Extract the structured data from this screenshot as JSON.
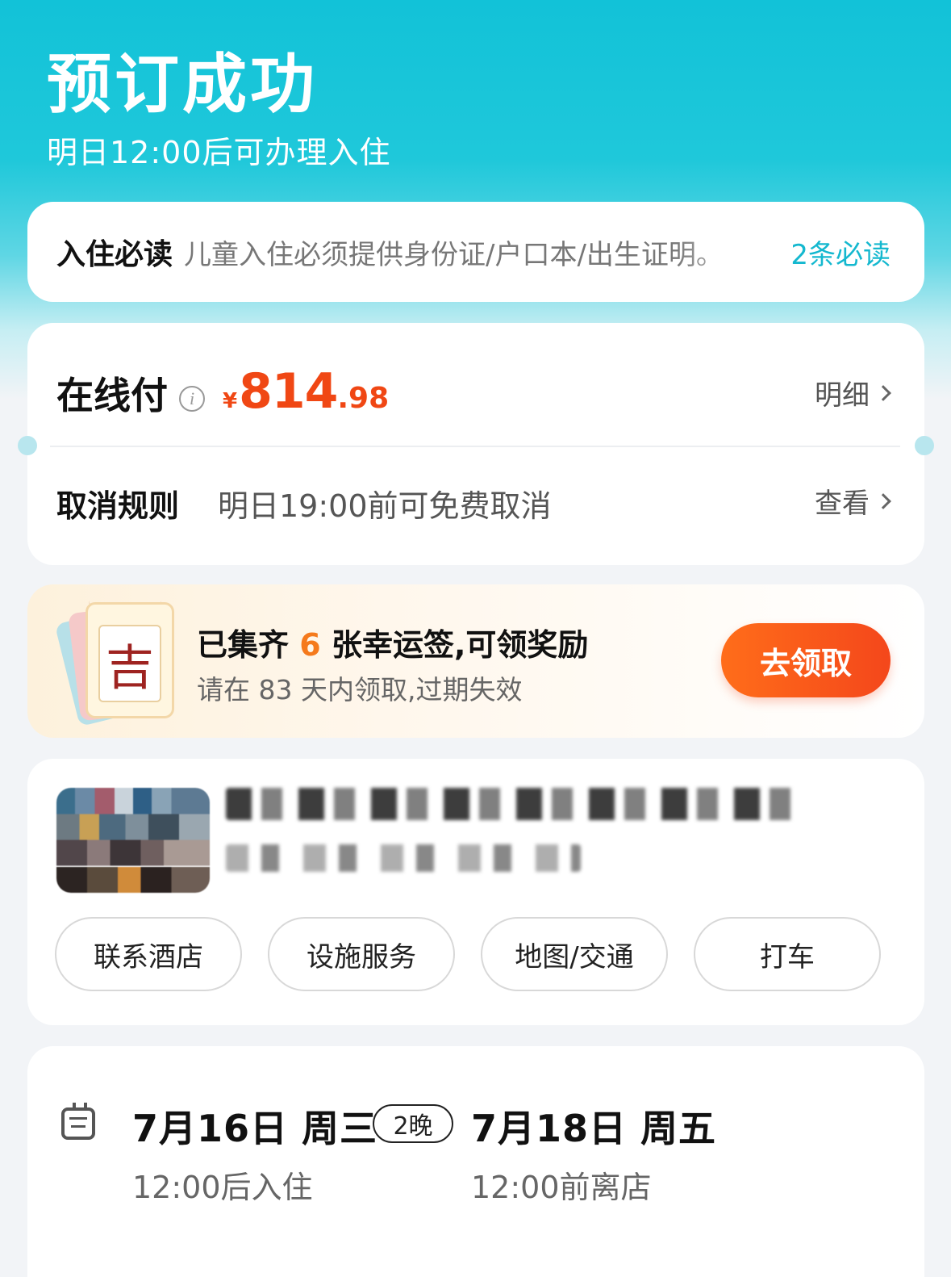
{
  "header": {
    "title": "预订成功",
    "subtitle": "明日12:00后可办理入住"
  },
  "notice": {
    "label": "入住必读",
    "text": "儿童入住必须提供身份证/户口本/出生证明。",
    "link": "2条必读"
  },
  "payment": {
    "label": "在线付",
    "currency_symbol": "¥",
    "price_integer": "814",
    "price_decimal": ".98",
    "detail_link": "明细",
    "cancel_label": "取消规则",
    "cancel_text": "明日19:00前可免费取消",
    "cancel_link": "查看"
  },
  "lucky": {
    "tag_char": "吉",
    "title_prefix": "已集齐",
    "count": "6",
    "title_suffix": "张幸运签,可领奖励",
    "subtitle": "请在 83 天内领取,过期失效",
    "button": "去领取"
  },
  "hotel": {
    "actions": [
      "联系酒店",
      "设施服务",
      "地图/交通",
      "打车"
    ]
  },
  "stay": {
    "checkin_date": "7月16日 周三",
    "nights": "2晚",
    "checkout_date": "7月18日 周五",
    "checkin_time": "12:00后入住",
    "checkout_time": "12:00前离店"
  },
  "colors": {
    "accent": "#14b8cf",
    "price": "#f04714",
    "claim_button": "#f4471b"
  }
}
